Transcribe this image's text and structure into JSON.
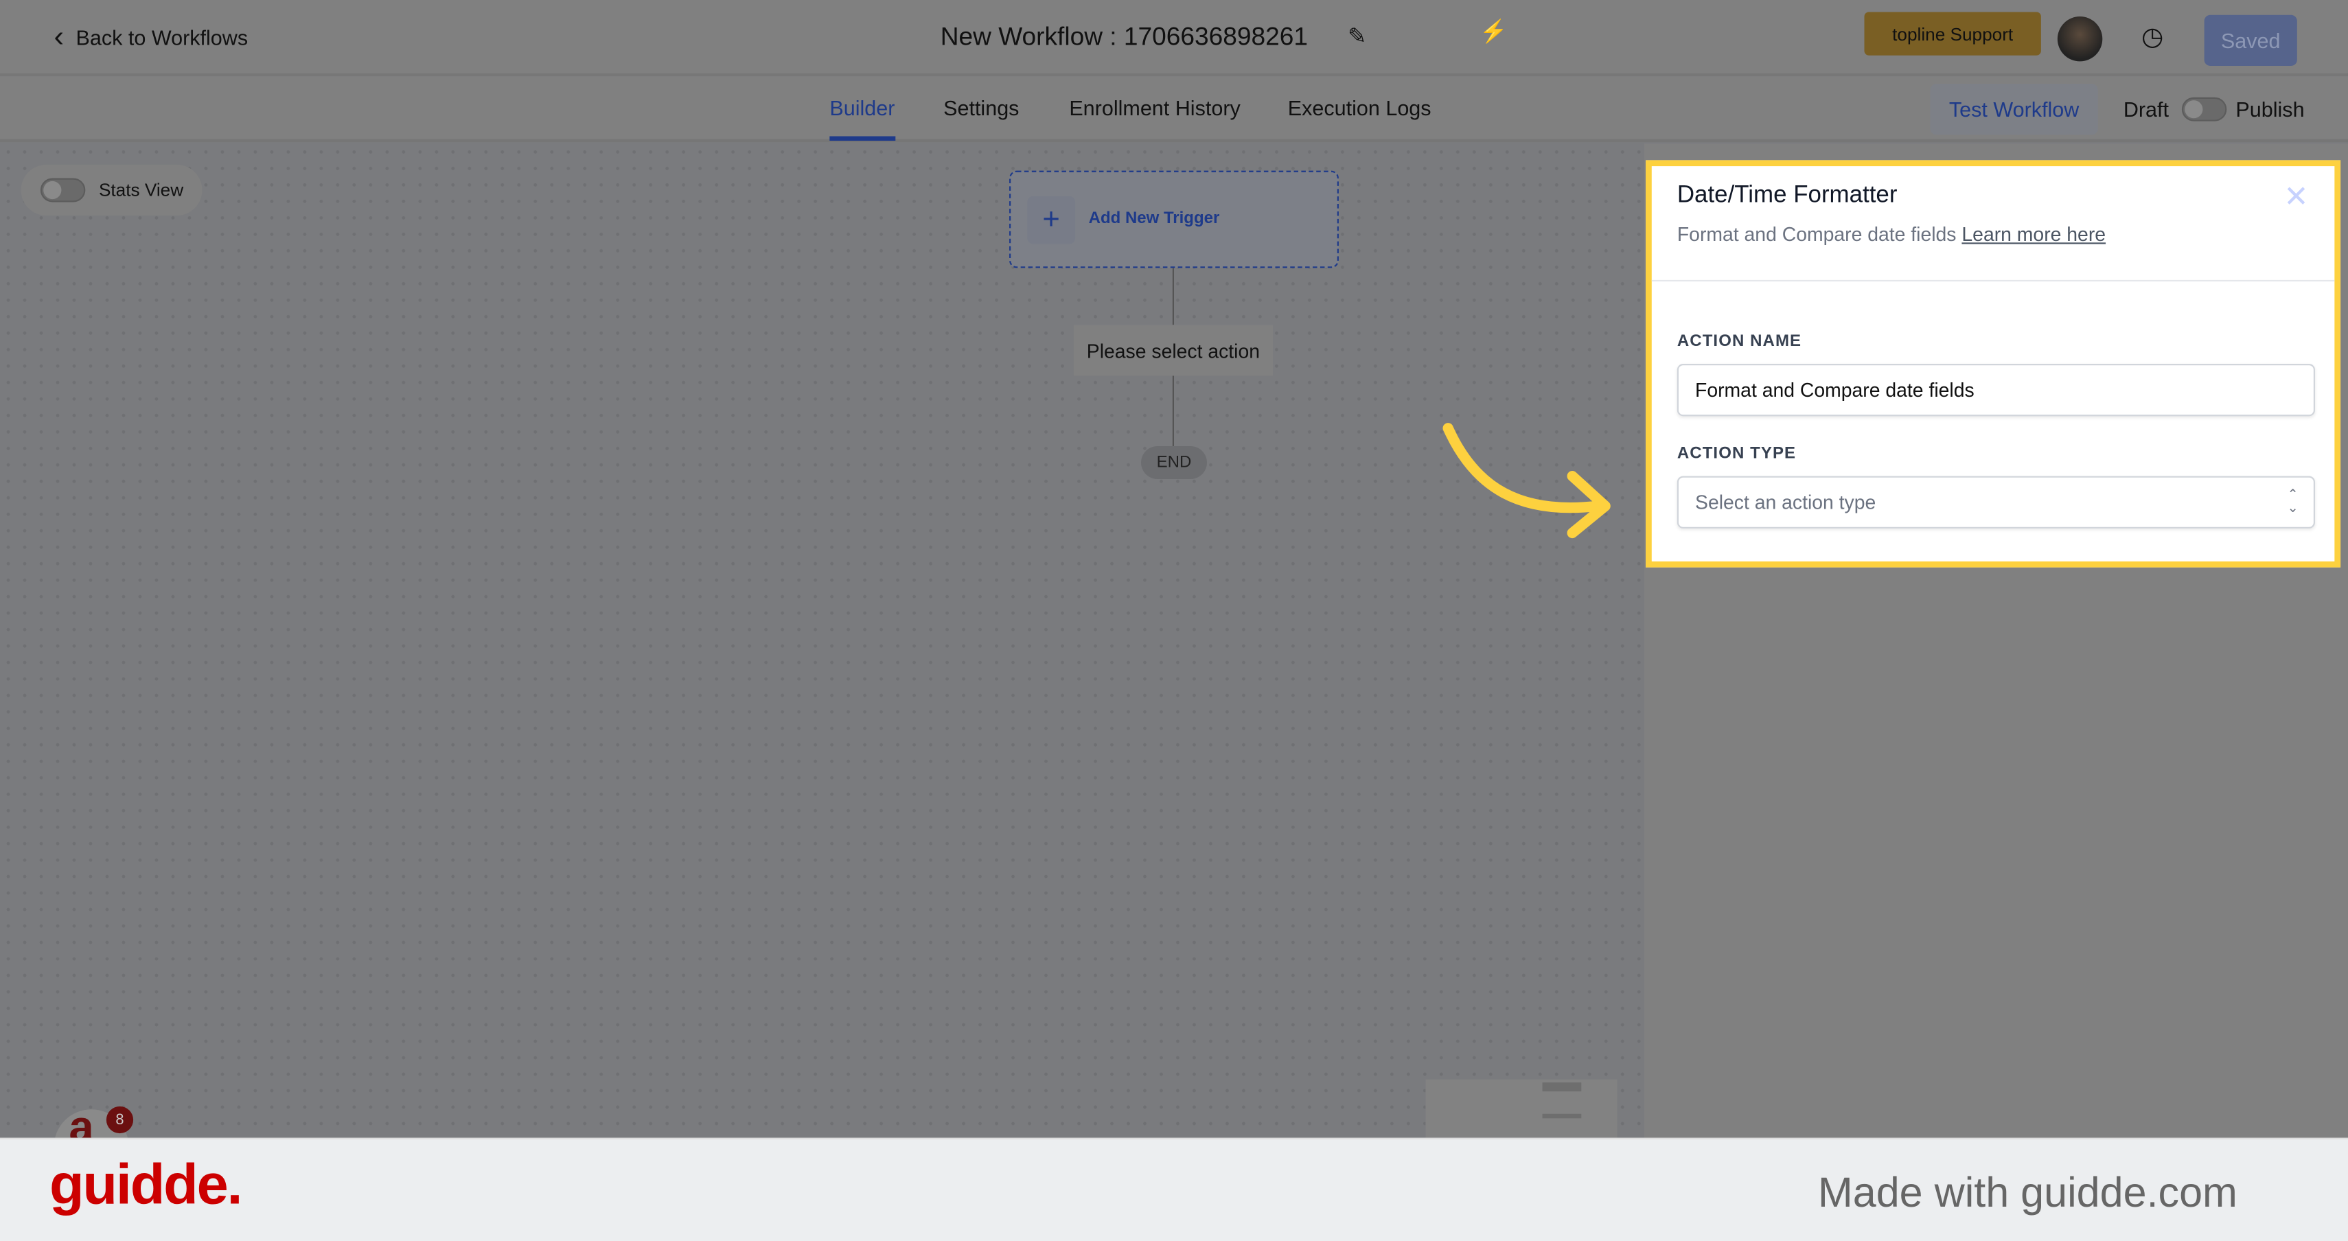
{
  "header": {
    "back_label": "Back to Workflows",
    "title": "New Workflow : 1706636898261",
    "support_label": "topline Support",
    "saved_label": "Saved"
  },
  "tabs": [
    {
      "label": "Builder",
      "active": true
    },
    {
      "label": "Settings"
    },
    {
      "label": "Enrollment History"
    },
    {
      "label": "Execution Logs"
    }
  ],
  "toolbar": {
    "test_label": "Test Workflow",
    "draft_label": "Draft",
    "publish_label": "Publish",
    "publish_toggle_on": false
  },
  "canvas": {
    "stats_view_label": "Stats View",
    "stats_view_on": false,
    "add_trigger_label": "Add New Trigger",
    "action_node_label": "Please select action",
    "end_label": "END",
    "notification_count": "8"
  },
  "panel": {
    "title": "Date/Time Formatter",
    "subtitle": "Format and Compare date fields",
    "learn_more": "Learn more here",
    "action_name_label": "ACTION NAME",
    "action_name_value": "Format and Compare date fields",
    "action_type_label": "ACTION TYPE",
    "action_type_placeholder": "Select an action type"
  },
  "footer": {
    "logo": "guidde.",
    "tagline": "Made with guidde.com"
  },
  "colors": {
    "highlight": "#fdd13f",
    "accent": "#1e3a8a",
    "brand": "#cc0000"
  }
}
